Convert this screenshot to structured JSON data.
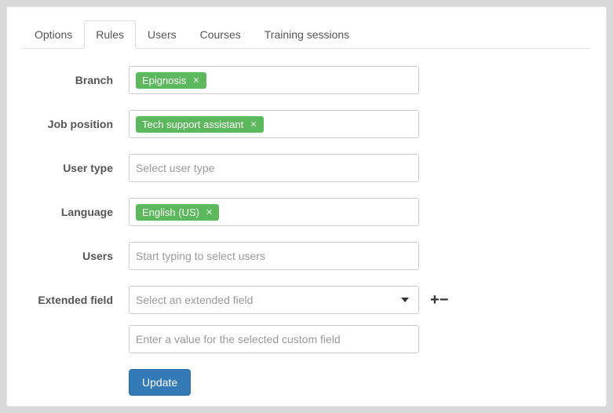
{
  "tabs": {
    "options": "Options",
    "rules": "Rules",
    "users": "Users",
    "courses": "Courses",
    "training": "Training sessions"
  },
  "form": {
    "branch": {
      "label": "Branch",
      "tag": "Epignosis"
    },
    "job": {
      "label": "Job position",
      "tag": "Tech support assistant"
    },
    "usertype": {
      "label": "User type",
      "placeholder": "Select user type"
    },
    "language": {
      "label": "Language",
      "tag": "English (US)"
    },
    "users": {
      "label": "Users",
      "placeholder": "Start typing to select users"
    },
    "extended": {
      "label": "Extended field",
      "placeholder": "Select an extended field",
      "value_placeholder": "Enter a value for the selected custom field"
    }
  },
  "buttons": {
    "update": "Update"
  }
}
